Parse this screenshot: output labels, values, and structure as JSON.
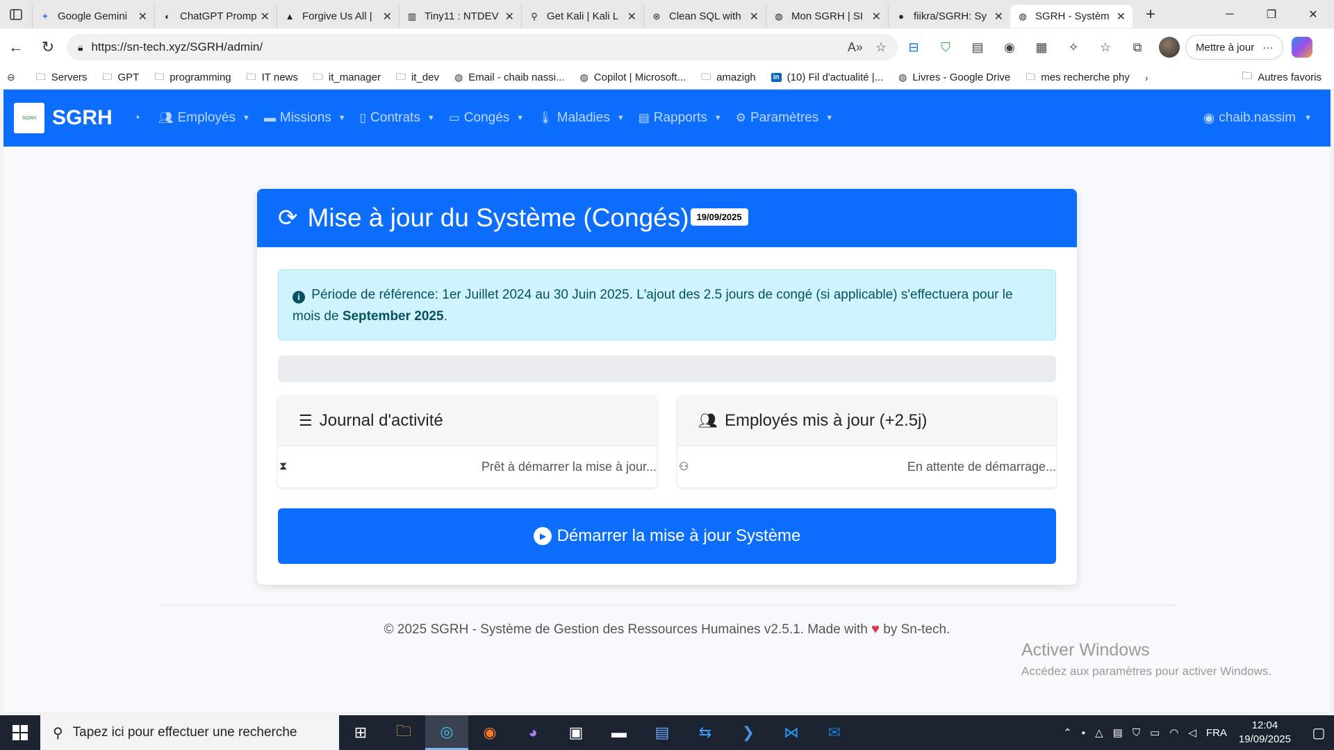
{
  "browser": {
    "tabs": [
      {
        "title": "Google Gemini",
        "icon": "gemini-icon"
      },
      {
        "title": "ChatGPT Promp",
        "icon": "chatgpt-icon"
      },
      {
        "title": "Forgive Us All |",
        "icon": "image-icon"
      },
      {
        "title": "Tiny11 : NTDEV",
        "icon": "archive-icon"
      },
      {
        "title": "Get Kali | Kali L",
        "icon": "kali-icon"
      },
      {
        "title": "Clean SQL with",
        "icon": "openai-icon"
      },
      {
        "title": "Mon SGRH | SI",
        "icon": "globe-icon"
      },
      {
        "title": "fiikra/SGRH: Sy",
        "icon": "github-icon"
      },
      {
        "title": "SGRH - Systèm",
        "icon": "globe-icon",
        "active": true
      }
    ],
    "url": "https://sn-tech.xyz/SGRH/admin/",
    "update_label": "Mettre à jour",
    "bookmarks": [
      {
        "label": "Servers",
        "icon": "folder-icon"
      },
      {
        "label": "GPT",
        "icon": "folder-icon"
      },
      {
        "label": "programming",
        "icon": "folder-icon"
      },
      {
        "label": "IT news",
        "icon": "folder-icon"
      },
      {
        "label": "it_manager",
        "icon": "folder-icon"
      },
      {
        "label": "it_dev",
        "icon": "folder-icon"
      },
      {
        "label": "Email - chaib nassi...",
        "icon": "globe-icon"
      },
      {
        "label": "Copilot | Microsoft...",
        "icon": "globe-icon"
      },
      {
        "label": "amazigh",
        "icon": "folder-icon"
      },
      {
        "label": "(10) Fil d'actualité |...",
        "icon": "linkedin-icon"
      },
      {
        "label": "Livres - Google Drive",
        "icon": "globe-icon"
      },
      {
        "label": "mes recherche phy",
        "icon": "folder-icon"
      }
    ],
    "other_bookmarks": "Autres favoris"
  },
  "app": {
    "brand": "SGRH",
    "logo_text": "SGRH",
    "nav": [
      {
        "label": "",
        "icon": "dashboard-icon"
      },
      {
        "label": "Employés",
        "icon": "users-icon"
      },
      {
        "label": "Missions",
        "icon": "bus-icon"
      },
      {
        "label": "Contrats",
        "icon": "file-icon"
      },
      {
        "label": "Congés",
        "icon": "calendar-icon"
      },
      {
        "label": "Maladies",
        "icon": "thermometer-icon"
      },
      {
        "label": "Rapports",
        "icon": "report-icon"
      },
      {
        "label": "Paramètres",
        "icon": "gear-icon"
      }
    ],
    "user": "chaib.nassim"
  },
  "card": {
    "title": "Mise à jour du Système (Congés)",
    "date_badge": "19/09/2025",
    "alert_text": "Période de référence: 1er Juillet 2024 au 30 Juin 2025. L'ajout des 2.5 jours de congé (si applicable) s'effectuera pour le mois de ",
    "alert_month": "September 2025",
    "alert_end": ".",
    "progress": 0,
    "journal_title": "Journal d'activité",
    "journal_status": "Prêt à démarrer la mise à jour...",
    "employees_title": "Employés mis à jour (+2.5j)",
    "employees_status": "En attente de démarrage...",
    "start_button": "Démarrer la mise à jour Système"
  },
  "footer": {
    "text_before": "© 2025 SGRH - Système de Gestion des Ressources Humaines v2.5.1. Made with",
    "text_after": "by Sn-tech."
  },
  "watermark": {
    "title": "Activer Windows",
    "subtitle": "Accédez aux paramètres pour activer Windows."
  },
  "taskbar": {
    "search_placeholder": "Tapez ici pour effectuer une recherche",
    "lang": "FRA",
    "time": "12:04",
    "date": "19/09/2025"
  },
  "colors": {
    "primary": "#0d6efd",
    "alert_bg": "#cff4fc",
    "alert_text": "#055160"
  }
}
